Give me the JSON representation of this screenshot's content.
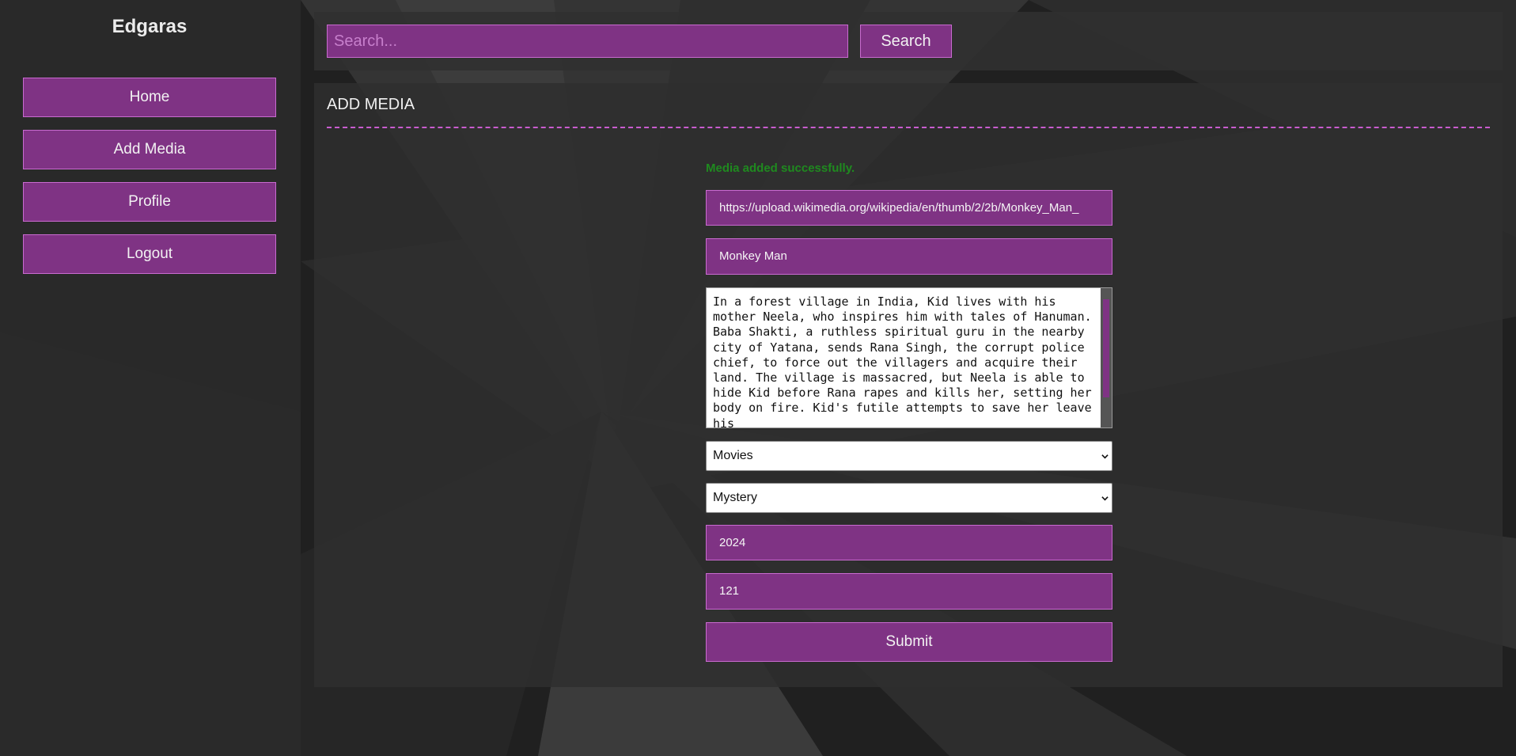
{
  "sidebar": {
    "brand": "Edgaras",
    "items": [
      {
        "label": "Home"
      },
      {
        "label": "Add Media"
      },
      {
        "label": "Profile"
      },
      {
        "label": "Logout"
      }
    ]
  },
  "search": {
    "placeholder": "Search...",
    "button_label": "Search"
  },
  "main": {
    "title": "ADD MEDIA",
    "success_message": "Media added successfully.",
    "form": {
      "image_url": "https://upload.wikimedia.org/wikipedia/en/thumb/2/2b/Monkey_Man_",
      "title": "Monkey Man",
      "description": "In a forest village in India, Kid lives with his mother Neela, who inspires him with tales of Hanuman. Baba Shakti, a ruthless spiritual guru in the nearby city of Yatana, sends Rana Singh, the corrupt police chief, to force out the villagers and acquire their land. The village is massacred, but Neela is able to hide Kid before Rana rapes and kills her, setting her body on fire. Kid's futile attempts to save her leave his",
      "type": "Movies",
      "genre": "Mystery",
      "year": "2024",
      "duration": "121",
      "submit_label": "Submit"
    }
  },
  "colors": {
    "accent": "#7f3384",
    "accent_border": "#c96bd0",
    "success": "#1f8a1f",
    "page_bg": "#1f1f1f"
  },
  "icons": {
    "select_arrow": "chevron-down-icon"
  }
}
